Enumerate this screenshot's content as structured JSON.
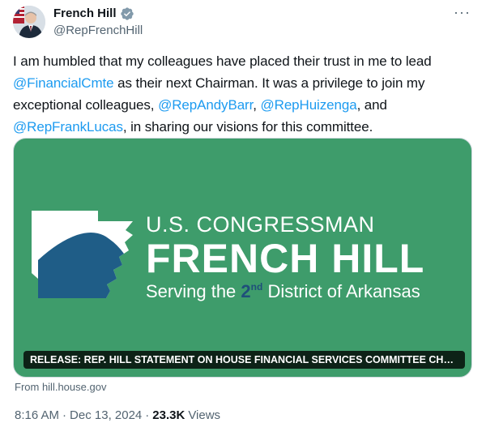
{
  "author": {
    "display_name": "French Hill",
    "handle": "@RepFrenchHill",
    "verified_icon": "verified-badge-icon",
    "more_icon": "more-icon"
  },
  "tweet": {
    "segments": [
      {
        "text": "I am humbled that my colleagues have placed their trust in me to lead ",
        "type": "text"
      },
      {
        "text": "@FinancialCmte",
        "type": "mention"
      },
      {
        "text": " as their next Chairman. It was a privilege to join my exceptional colleagues, ",
        "type": "text"
      },
      {
        "text": "@RepAndyBarr",
        "type": "mention"
      },
      {
        "text": ", ",
        "type": "text"
      },
      {
        "text": "@RepHuizenga",
        "type": "mention"
      },
      {
        "text": ", and ",
        "type": "text"
      },
      {
        "text": "@RepFrankLucas",
        "type": "mention"
      },
      {
        "text": ", in sharing our visions for this committee.",
        "type": "text"
      }
    ]
  },
  "card": {
    "line1": "U.S. CONGRESSMAN",
    "line2": "FRENCH HILL",
    "line3_a": "Serving the ",
    "line3_num": "2",
    "line3_sup": "nd",
    "line3_b": " District of Arkansas",
    "caption": "RELEASE: REP. HILL STATEMENT ON HOUSE FINANCIAL SERVICES COMMITTEE CHAI...",
    "source": "From hill.house.gov",
    "background_color": "#3e9c6b"
  },
  "meta": {
    "time": "8:16 AM",
    "sep1": "·",
    "date": "Dec 13, 2024",
    "sep2": "·",
    "views_count": "23.3K",
    "views_label": "Views"
  },
  "colors": {
    "mention": "#1d9bf0",
    "secondary_text": "#536471",
    "primary_text": "#0f1419"
  }
}
